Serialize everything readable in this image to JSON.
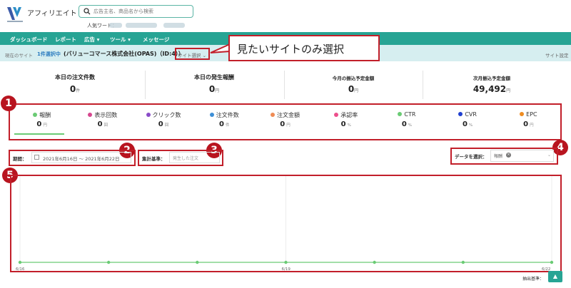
{
  "header": {
    "brand": "アフィリエイト",
    "search_placeholder": "広告主名、商品名から検索",
    "popular_words_label": "人気ワード："
  },
  "nav": {
    "items": [
      "ダッシュボード",
      "レポート",
      "広告 ▾",
      "ツール ▾",
      "メッセージ"
    ]
  },
  "subbar": {
    "current_site_label": "現在のサイト",
    "selected_count": "1件選択中",
    "company": "(バリューコマース株式会社(OPAS)（ID:4））",
    "site_select": "サイト選択 ⌄",
    "site_settings": "サイト設定"
  },
  "callout": {
    "text": "見たいサイトのみ選択"
  },
  "summary": [
    {
      "label": "本日の注文件数",
      "value": "0",
      "unit": "件"
    },
    {
      "label": "本日の発生報酬",
      "value": "0",
      "unit": "円"
    },
    {
      "label": "今月の振込予定金額",
      "value": "0",
      "unit": "円"
    },
    {
      "label": "次月振込予定金額",
      "value": "49,492",
      "unit": "円"
    }
  ],
  "metrics": [
    {
      "label": "報酬",
      "value": "0",
      "unit": "円",
      "color": "#6acb74"
    },
    {
      "label": "表示回数",
      "value": "0",
      "unit": "回",
      "color": "#d6478f"
    },
    {
      "label": "クリック数",
      "value": "0",
      "unit": "回",
      "color": "#8a4cc8"
    },
    {
      "label": "注文件数",
      "value": "0",
      "unit": "件",
      "color": "#3d8fd6"
    },
    {
      "label": "注文金額",
      "value": "0",
      "unit": "円",
      "color": "#ef8c55"
    },
    {
      "label": "承認率",
      "value": "0",
      "unit": "%",
      "color": "#ec4f8c"
    },
    {
      "label": "CTR",
      "value": "0",
      "unit": "%",
      "color": "#6acb74"
    },
    {
      "label": "CVR",
      "value": "0",
      "unit": "%",
      "color": "#1f3fd0"
    },
    {
      "label": "EPC",
      "value": "0",
      "unit": "円",
      "color": "#ef8c20"
    }
  ],
  "filters": {
    "period_label": "期間：",
    "period_value": "2021年6月16日 〜 2021年6月22日",
    "basis_label": "集計基準：",
    "basis_placeholder": "発生した注文",
    "data_label": "データを選択：",
    "data_chip": "報酬"
  },
  "badges": [
    "1",
    "2",
    "3",
    "4",
    "5"
  ],
  "chart_data": {
    "type": "line",
    "x": [
      "6/16",
      "6/17",
      "6/18",
      "6/19",
      "6/20",
      "6/21",
      "6/22"
    ],
    "series": [
      {
        "name": "報酬",
        "values": [
          0,
          0,
          0,
          0,
          0,
          0,
          0
        ],
        "color": "#6acb74"
      }
    ],
    "tick_labels": [
      "6/16",
      "6/19",
      "6/22"
    ]
  },
  "footer": {
    "extract_basis": "抽出基準：",
    "scroll_top": "▲"
  }
}
